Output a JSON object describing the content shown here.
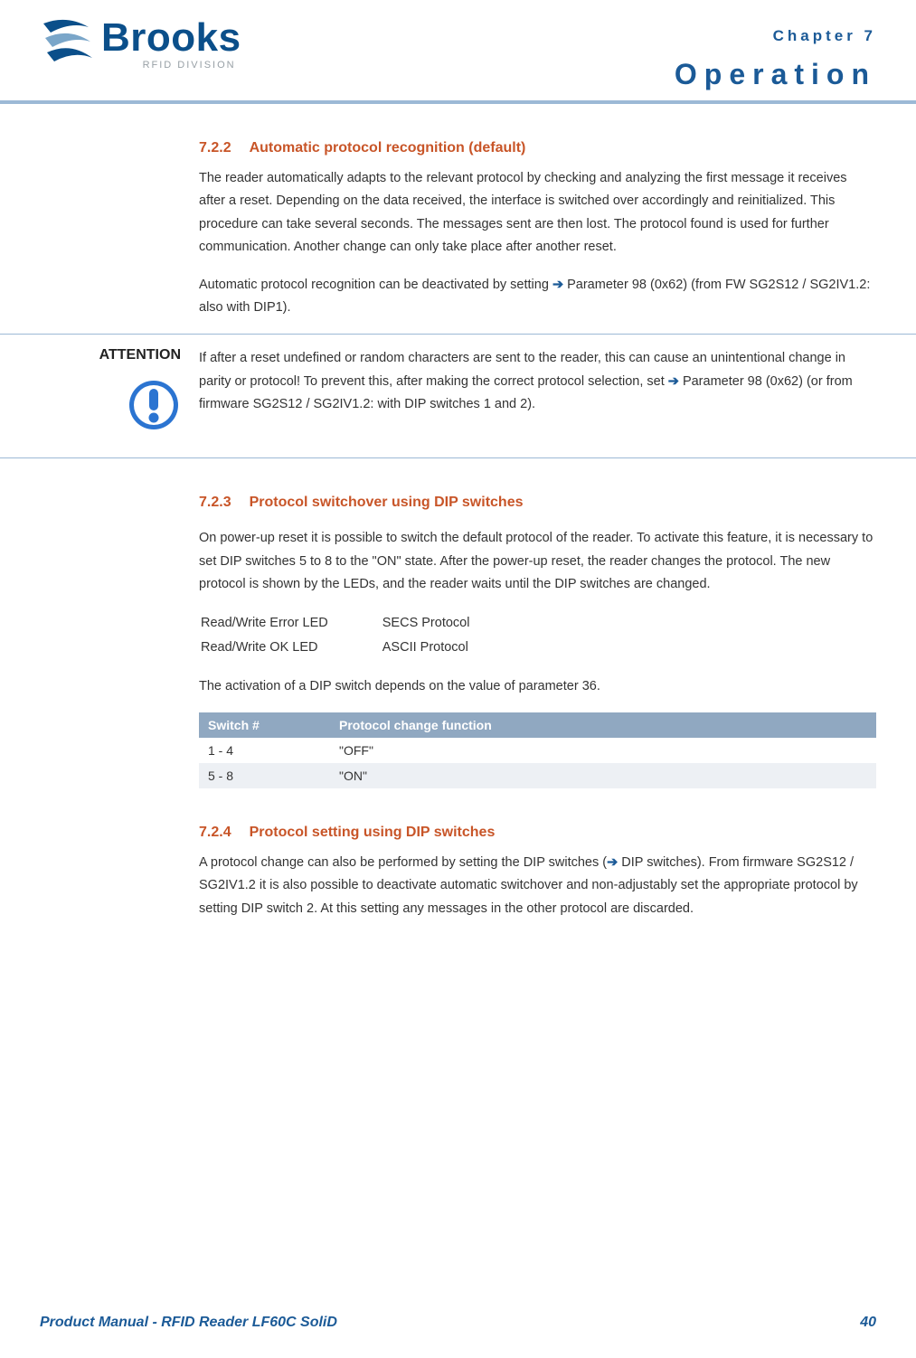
{
  "header": {
    "brand": "Brooks",
    "tagline": "RFID DIVISION",
    "chapter_label": "Chapter 7",
    "chapter_title": "Operation"
  },
  "s722": {
    "num": "7.2.2",
    "title": "Automatic protocol recognition (default)",
    "p1": "The reader automatically adapts to the relevant protocol by checking and analyzing the first message it receives after a reset. Depending on the data received, the interface is switched over accordingly and reinitialized. This procedure can take several seconds. The messages sent are then lost. The protocol found is used for further communication. Another change can only take place after another reset.",
    "p2a": "Automatic protocol recognition can be deactivated by setting ",
    "p2b": " Parameter 98 (0x62) (from FW SG2S12 / SG2IV1.2: also with DIP1)."
  },
  "attention": {
    "label": "ATTENTION",
    "t1": "If after a reset undefined or random characters are sent to the reader, this can cause an unintentional change in parity or protocol! To prevent this, after making the correct protocol selection, set ",
    "t2": " Parameter 98 (0x62) (or from firmware SG2S12 / SG2IV1.2: with DIP switches 1 and 2)."
  },
  "s723": {
    "num": "7.2.3",
    "title": "Protocol switchover using DIP switches",
    "p1": "On power-up reset it is possible to switch the default protocol of the reader. To activate this feature, it is necessary to set DIP switches 5 to 8 to the \"ON\" state. After the power-up reset, the reader changes the protocol. The new protocol is shown by the LEDs, and the reader waits until the DIP switches are changed.",
    "led": [
      {
        "a": "Read/Write Error LED",
        "b": "SECS Protocol"
      },
      {
        "a": "Read/Write OK LED",
        "b": "ASCII Protocol"
      }
    ],
    "p2": "The activation of a DIP switch depends on the value of parameter 36.",
    "th1": "Switch #",
    "th2": "Protocol change function",
    "rows": [
      {
        "a": "1 - 4",
        "b": "\"OFF\""
      },
      {
        "a": "5 - 8",
        "b": "\"ON\""
      }
    ]
  },
  "s724": {
    "num": "7.2.4",
    "title": "Protocol setting using DIP switches",
    "p1a": "A protocol change can also be performed by setting the DIP switches (",
    "p1b": " DIP switches). From firmware SG2S12 / SG2IV1.2 it is also possible to deactivate automatic switchover and non-adjustably set the appropriate protocol by setting DIP switch 2. At this setting any messages in the other protocol are discarded."
  },
  "footer": {
    "left": "Product Manual - RFID Reader LF60C SoliD",
    "right": "40"
  },
  "arrow": "➔"
}
